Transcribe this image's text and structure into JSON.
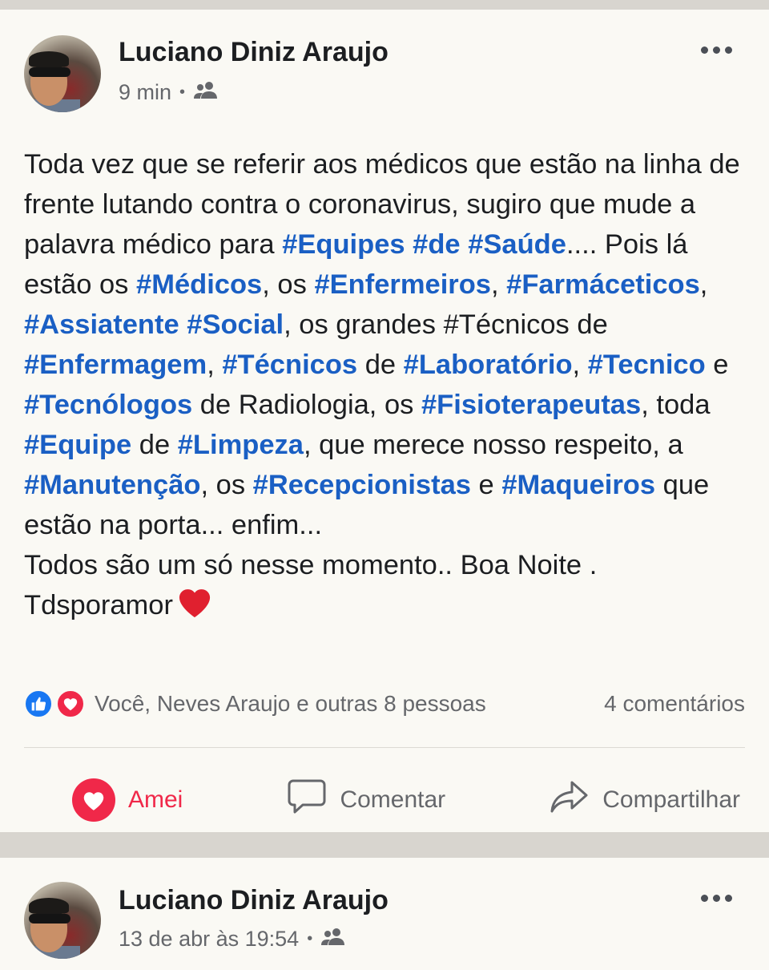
{
  "posts": [
    {
      "author": "Luciano Diniz Araujo",
      "time": "9 min",
      "audience_icon": "friends-icon",
      "text_parts": [
        {
          "t": "Toda vez que se referir aos médicos que estão na linha de frente lutando contra o coronavirus, sugiro que mude a palavra médico para "
        },
        {
          "t": "#Equipes",
          "tag": true
        },
        {
          "t": " "
        },
        {
          "t": "#de",
          "tag": true
        },
        {
          "t": " "
        },
        {
          "t": "#Saúde",
          "tag": true
        },
        {
          "t": ".... Pois lá estão os "
        },
        {
          "t": "#Médicos",
          "tag": true
        },
        {
          "t": ", os "
        },
        {
          "t": "#Enfermeiros",
          "tag": true
        },
        {
          "t": ", "
        },
        {
          "t": "#Farmáceticos",
          "tag": true
        },
        {
          "t": ", "
        },
        {
          "t": "#Assiatente",
          "tag": true
        },
        {
          "t": " "
        },
        {
          "t": "#Social",
          "tag": true
        },
        {
          "t": ", os grandes #Técnicos de "
        },
        {
          "t": "#Enfermagem",
          "tag": true
        },
        {
          "t": ", "
        },
        {
          "t": "#Técnicos",
          "tag": true
        },
        {
          "t": " de "
        },
        {
          "t": "#Laboratório",
          "tag": true
        },
        {
          "t": ", "
        },
        {
          "t": "#Tecnico",
          "tag": true
        },
        {
          "t": " e "
        },
        {
          "t": "#Tecnólogos",
          "tag": true
        },
        {
          "t": " de Radiologia, os "
        },
        {
          "t": "#Fisioterapeutas",
          "tag": true
        },
        {
          "t": ", toda "
        },
        {
          "t": "#Equipe",
          "tag": true
        },
        {
          "t": " de "
        },
        {
          "t": "#Limpeza",
          "tag": true
        },
        {
          "t": ", que merece nosso respeito, a "
        },
        {
          "t": "#Manutenção",
          "tag": true
        },
        {
          "t": ", os "
        },
        {
          "t": "#Recepcionistas",
          "tag": true
        },
        {
          "t": " e "
        },
        {
          "t": "#Maqueiros",
          "tag": true
        },
        {
          "t": " que estão na porta... enfim...",
          "br_after": true
        },
        {
          "t": "Todos são um só nesse momento.. Boa Noite .",
          "br_after": true
        },
        {
          "t": "Tdsporamor"
        }
      ],
      "reactions_text": "Você, Neves Araujo e outras 8 pessoas",
      "comments_text": "4 comentários",
      "actions": {
        "love": "Amei",
        "comment": "Comentar",
        "share": "Compartilhar"
      }
    },
    {
      "author": "Luciano Diniz Araujo",
      "time": "13 de abr às 19:54",
      "audience_icon": "friends-icon"
    }
  ],
  "colors": {
    "hashtag": "#1a5fc4",
    "love": "#f02849",
    "like": "#1877f2",
    "muted": "#65676b"
  }
}
